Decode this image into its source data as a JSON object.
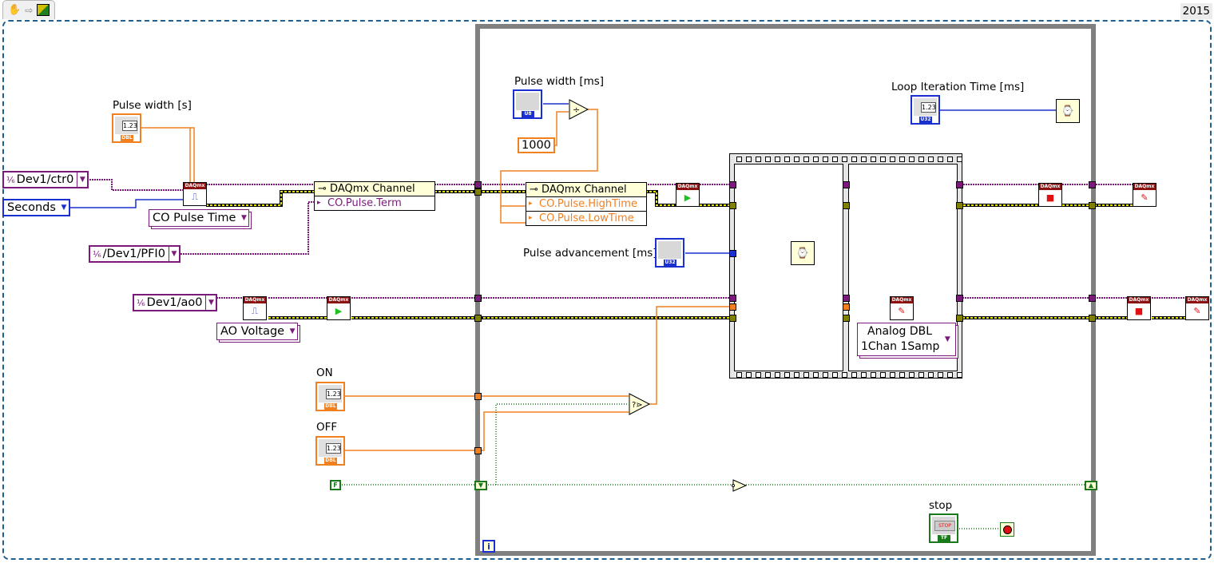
{
  "toolbar": {
    "icons": [
      "hand-tool-icon",
      "arrow-icon",
      "labview-vi-icon"
    ],
    "version": "2015"
  },
  "outside_loop": {
    "pulse_width_s": {
      "label": "Pulse width [s]",
      "value_display": "1.23",
      "type": "DBL"
    },
    "counter_channel": {
      "value": "Dev1/ctr0"
    },
    "units": {
      "value": "Seconds"
    },
    "co_create_type": {
      "value": "CO Pulse Time"
    },
    "pfi_terminal": {
      "value": "/Dev1/PFI0"
    },
    "property_node_1": {
      "title": "DAQmx Channel",
      "properties": [
        "CO.Pulse.Term"
      ]
    },
    "ao_channel": {
      "value": "Dev1/ao0"
    },
    "ao_create_type": {
      "value": "AO Voltage"
    },
    "on_control": {
      "label": "ON",
      "value_display": "1.23",
      "type": "DBL"
    },
    "off_control": {
      "label": "OFF",
      "value_display": "1.23",
      "type": "DBL"
    },
    "false_constant": "F",
    "daqmx_header": "DAQmx"
  },
  "while_loop": {
    "pulse_width_ms": {
      "label": "Pulse width [ms]",
      "type": "U8",
      "scale": [
        "0",
        "5",
        "10"
      ]
    },
    "constant_1000": "1000",
    "property_node_2": {
      "title": "DAQmx Channel",
      "properties": [
        "CO.Pulse.HighTime",
        "CO.Pulse.LowTime"
      ]
    },
    "pulse_advancement": {
      "label": "Pulse advancement [ms]",
      "type": "U32",
      "scale": [
        "0",
        "5",
        "10"
      ]
    },
    "loop_iteration_time": {
      "label": "Loop Iteration Time [ms]",
      "value_display": "1.23",
      "type": "U32"
    },
    "write_type": {
      "line1": "Analog DBL",
      "line2": "1Chan 1Samp"
    },
    "stop_button": {
      "label": "stop",
      "button_text": "STOP",
      "type": "TF"
    },
    "iteration_terminal": "i",
    "wires": {
      "task_color": "#7a1a7a",
      "error_color": "#c8c800",
      "numeric_color": "#f08020",
      "integer_color": "#1a30d0",
      "boolean_color": "#1a7a1a"
    }
  }
}
